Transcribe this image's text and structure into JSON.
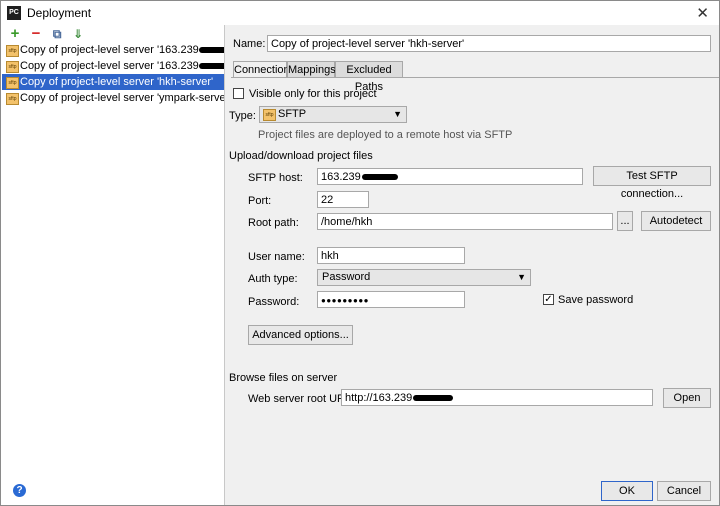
{
  "window": {
    "title": "Deployment",
    "app_icon": "PC"
  },
  "toolbar": {
    "add": "+",
    "remove": "−",
    "copy": "⧉",
    "move": "⇓"
  },
  "tree": {
    "items": [
      {
        "label": "Copy of project-level server '163.239",
        "selected": false
      },
      {
        "label": "Copy of project-level server '163.239",
        "selected": false
      },
      {
        "label": "Copy of project-level server 'hkh-server'",
        "selected": true
      },
      {
        "label": "Copy of project-level server 'ympark-server'",
        "selected": false
      }
    ],
    "icon_text": "sftp"
  },
  "name": {
    "label": "Name:",
    "value": "Copy of project-level server 'hkh-server'"
  },
  "tabs": [
    {
      "label": "Connection",
      "active": true
    },
    {
      "label": "Mappings",
      "active": false
    },
    {
      "label": "Excluded Paths",
      "active": false
    }
  ],
  "visible_only": {
    "label": "Visible only for this project",
    "checked": false
  },
  "type": {
    "label": "Type:",
    "value": "SFTP",
    "description": "Project files are deployed to a remote host via SFTP"
  },
  "upload_section": {
    "title": "Upload/download project files"
  },
  "host": {
    "label": "SFTP host:",
    "value": "163.239",
    "test_button": "Test SFTP connection..."
  },
  "port": {
    "label": "Port:",
    "value": "22"
  },
  "root_path": {
    "label": "Root path:",
    "value": "/home/hkh",
    "browse": "...",
    "autodetect": "Autodetect"
  },
  "user": {
    "label": "User name:",
    "value": "hkh"
  },
  "auth": {
    "label": "Auth type:",
    "value": "Password"
  },
  "password": {
    "label": "Password:",
    "value": "●●●●●●●●●",
    "save_label": "Save password",
    "save_checked": true
  },
  "advanced": {
    "label": "Advanced options..."
  },
  "browse_section": {
    "title": "Browse files on server"
  },
  "web_root": {
    "label": "Web server root URL:",
    "value": "http://163.239",
    "open": "Open"
  },
  "footer": {
    "ok": "OK",
    "cancel": "Cancel",
    "help": "?"
  }
}
